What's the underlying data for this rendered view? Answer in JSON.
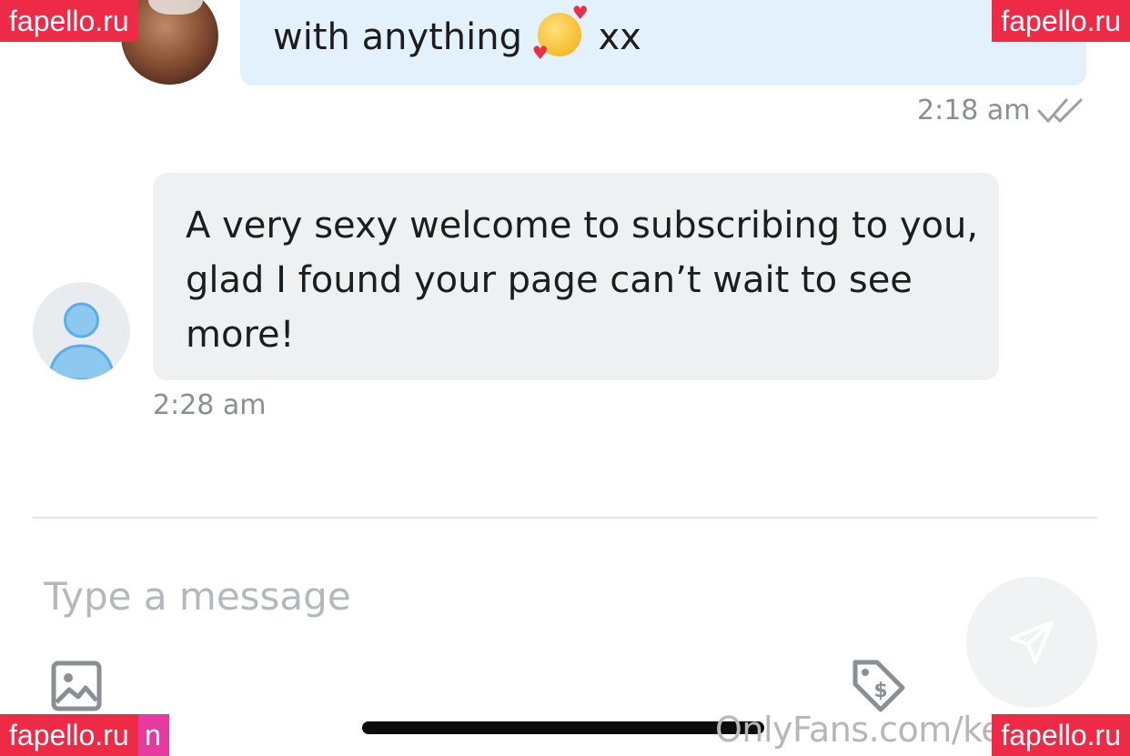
{
  "conversation": {
    "sent_message": {
      "text_before_emoji": "with anything",
      "emoji": "smiling-face-with-hearts",
      "text_after_emoji": "xx",
      "time": "2:18 am",
      "status": "read"
    },
    "received_message": {
      "text": "A very sexy welcome to subscribing to you, glad I found your page can’t wait to see more!",
      "time": "2:28 am"
    }
  },
  "composer": {
    "placeholder": "Type a message",
    "value": ""
  },
  "icons": {
    "image_attach": "image-icon",
    "tip": "price-tag-dollar-icon",
    "send": "paper-plane-icon",
    "read_status": "double-check-icon",
    "default_avatar": "user-icon"
  },
  "footer": {
    "url": "OnlyFans.com/ke"
  },
  "watermarks": {
    "label": "fapello.ru",
    "bottom_left_fragment": "n"
  },
  "colors": {
    "sent_bubble": "#e2f1fb",
    "received_bubble": "#eef0f2",
    "watermark": "#ee2a46",
    "avatar_accent": "#5aaee6"
  }
}
